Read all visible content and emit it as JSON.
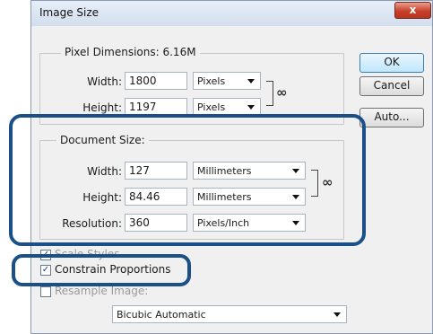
{
  "dialog": {
    "title": "Image Size",
    "close_label": "x",
    "buttons": {
      "ok": "OK",
      "cancel": "Cancel",
      "auto": "Auto..."
    }
  },
  "pixel_dimensions": {
    "legend": "Pixel Dimensions:",
    "size": "6.16M",
    "width_label": "Width:",
    "width_value": "1800",
    "width_unit": "Pixels",
    "height_label": "Height:",
    "height_value": "1197",
    "height_unit": "Pixels"
  },
  "document_size": {
    "legend": "Document Size:",
    "width_label": "Width:",
    "width_value": "127",
    "width_unit": "Millimeters",
    "height_label": "Height:",
    "height_value": "84.46",
    "height_unit": "Millimeters",
    "resolution_label": "Resolution:",
    "resolution_value": "360",
    "resolution_unit": "Pixels/Inch"
  },
  "options": {
    "scale_styles_label": "Scale Styles",
    "scale_styles_checked": true,
    "constrain_label": "Constrain Proportions",
    "constrain_checked": true,
    "resample_label": "Resample Image:",
    "resample_checked": false,
    "resample_method": "Bicubic Automatic"
  },
  "icons": {
    "link": "chain-link-icon",
    "dropdown": "chevron-down-icon",
    "check": "checkmark-icon"
  },
  "colors": {
    "highlight": "#1b4f87",
    "dialog_bg": "#f0f0f0",
    "close_button": "#c9402a"
  }
}
